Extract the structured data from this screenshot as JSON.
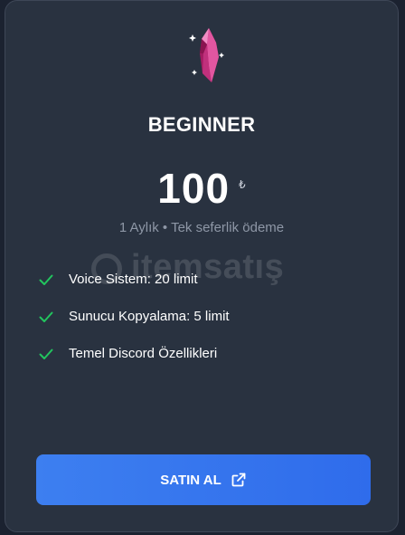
{
  "plan": {
    "icon": "crystal-gem-icon",
    "title": "BEGINNER",
    "price": "100",
    "currency": "₺",
    "billing": "1 Aylık • Tek seferlik ödeme"
  },
  "features": [
    {
      "icon": "check-icon",
      "label": "Voice Sistem: 20 limit"
    },
    {
      "icon": "check-icon",
      "label": "Sunucu Kopyalama: 5 limit"
    },
    {
      "icon": "check-icon",
      "label": "Temel Discord Özellikleri"
    }
  ],
  "watermark": {
    "text": "itemsatış"
  },
  "button": {
    "label": "SATIN AL",
    "icon": "external-link-icon"
  },
  "colors": {
    "background": "#1b2230",
    "card": "#293240",
    "accent": "#3479ef",
    "check": "#22c55e",
    "gem": "#d6428f"
  }
}
